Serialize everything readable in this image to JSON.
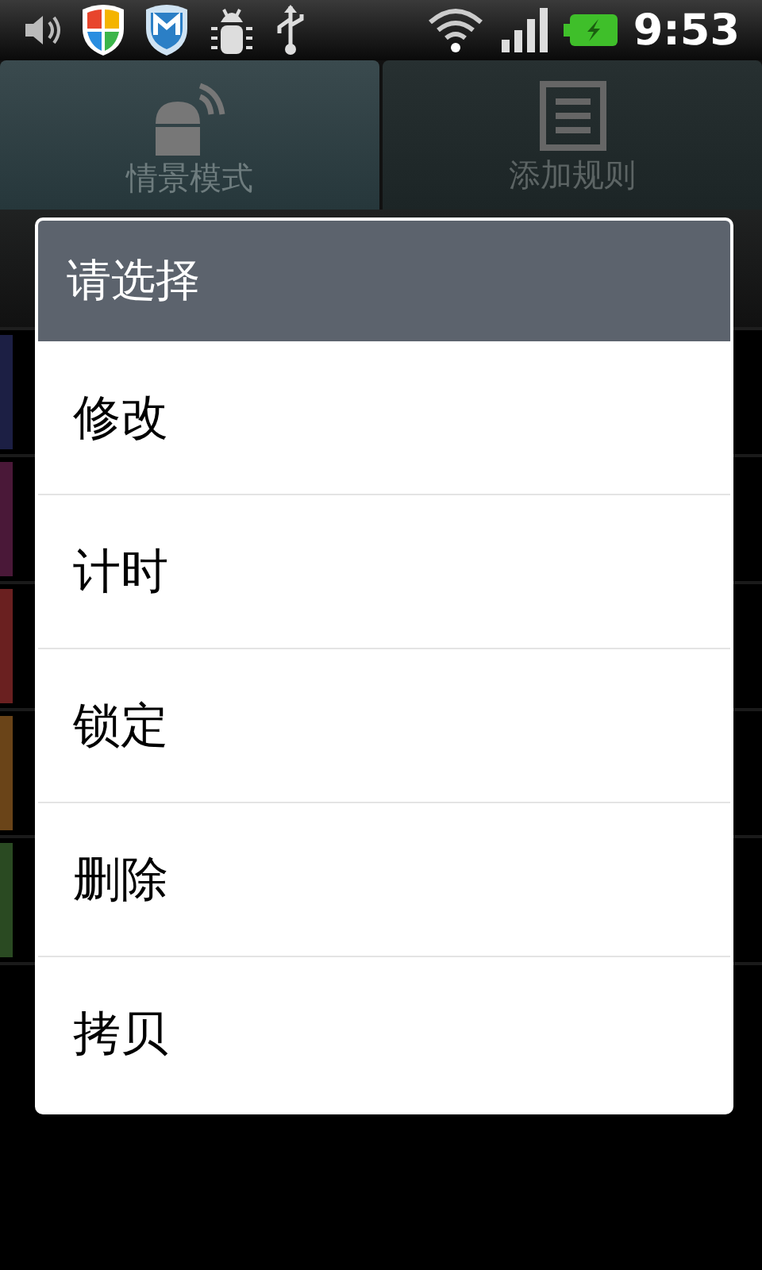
{
  "status_bar": {
    "time": "9:53"
  },
  "tabs": [
    {
      "label": "情景模式",
      "selected": true
    },
    {
      "label": "添加规则",
      "selected": false
    }
  ],
  "background_rows": [
    {
      "color": "#1c1f44"
    },
    {
      "color": "#4a1838"
    },
    {
      "color": "#6a2020"
    },
    {
      "color": "#6a4418"
    },
    {
      "color": "#2a4a22"
    }
  ],
  "dialog": {
    "title": "请选择",
    "options": [
      "修改",
      "计时",
      "锁定",
      "删除",
      "拷贝"
    ]
  }
}
